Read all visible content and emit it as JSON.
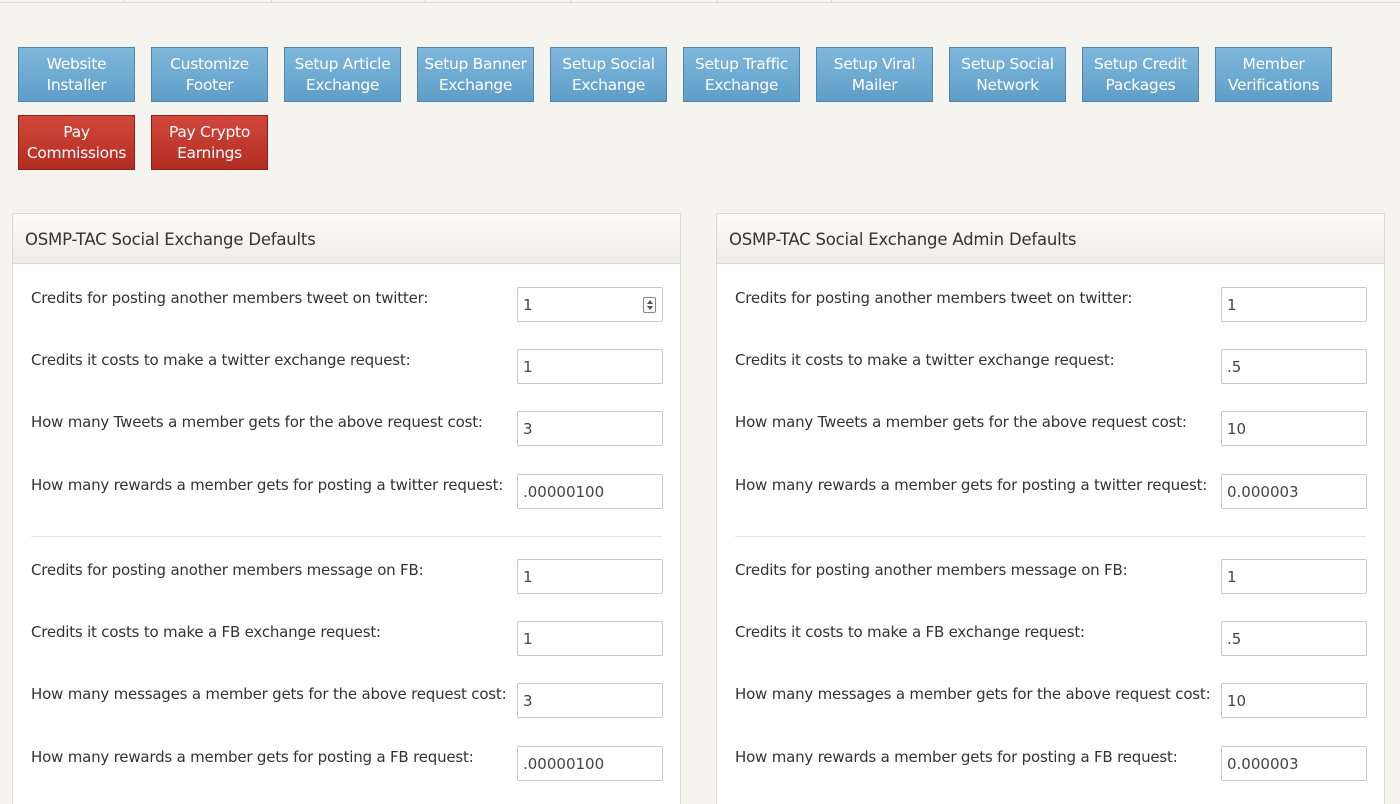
{
  "nav_buttons": [
    {
      "label": "Website\nInstaller",
      "style": "blue"
    },
    {
      "label": "Customize\nFooter",
      "style": "blue"
    },
    {
      "label": "Setup Article\nExchange",
      "style": "blue"
    },
    {
      "label": "Setup Banner\nExchange",
      "style": "blue"
    },
    {
      "label": "Setup Social\nExchange",
      "style": "blue"
    },
    {
      "label": "Setup Traffic\nExchange",
      "style": "blue"
    },
    {
      "label": "Setup Viral\nMailer",
      "style": "blue"
    },
    {
      "label": "Setup Social\nNetwork",
      "style": "blue"
    },
    {
      "label": "Setup Credit\nPackages",
      "style": "blue"
    },
    {
      "label": "Member\nVerifications",
      "style": "blue"
    },
    {
      "label": "Pay\nCommissions",
      "style": "red"
    },
    {
      "label": "Pay Crypto\nEarnings",
      "style": "red"
    }
  ],
  "colors": {
    "button_blue": "#6aa8d2",
    "button_red": "#c0392b",
    "background": "#f5f4ef"
  },
  "panels": [
    {
      "title": "OSMP-TAC Social Exchange Defaults",
      "twitter": [
        {
          "label": "Credits for posting another members tweet on twitter:",
          "value": "1",
          "spinner": true
        },
        {
          "label": "Credits it costs to make a twitter exchange request:",
          "value": "1"
        },
        {
          "label": "How many Tweets a member gets for the above request cost:",
          "value": "3"
        },
        {
          "label": "How many rewards a member gets for posting a twitter request:",
          "value": ".00000100"
        }
      ],
      "fb": [
        {
          "label": "Credits for posting another members message on FB:",
          "value": "1"
        },
        {
          "label": "Credits it costs to make a FB exchange request:",
          "value": "1"
        },
        {
          "label": "How many messages a member gets for the above request cost:",
          "value": "3"
        },
        {
          "label": "How many rewards a member gets for posting a FB request:",
          "value": ".00000100"
        }
      ]
    },
    {
      "title": "OSMP-TAC Social Exchange Admin Defaults",
      "twitter": [
        {
          "label": "Credits for posting another members tweet on twitter:",
          "value": "1"
        },
        {
          "label": "Credits it costs to make a twitter exchange request:",
          "value": ".5"
        },
        {
          "label": "How many Tweets a member gets for the above request cost:",
          "value": "10"
        },
        {
          "label": "How many rewards a member gets for posting a twitter request:",
          "value": "0.000003"
        }
      ],
      "fb": [
        {
          "label": "Credits for posting another members message on FB:",
          "value": "1"
        },
        {
          "label": "Credits it costs to make a FB exchange request:",
          "value": ".5"
        },
        {
          "label": "How many messages a member gets for the above request cost:",
          "value": "10"
        },
        {
          "label": "How many rewards a member gets for posting a FB request:",
          "value": "0.000003"
        }
      ]
    }
  ]
}
